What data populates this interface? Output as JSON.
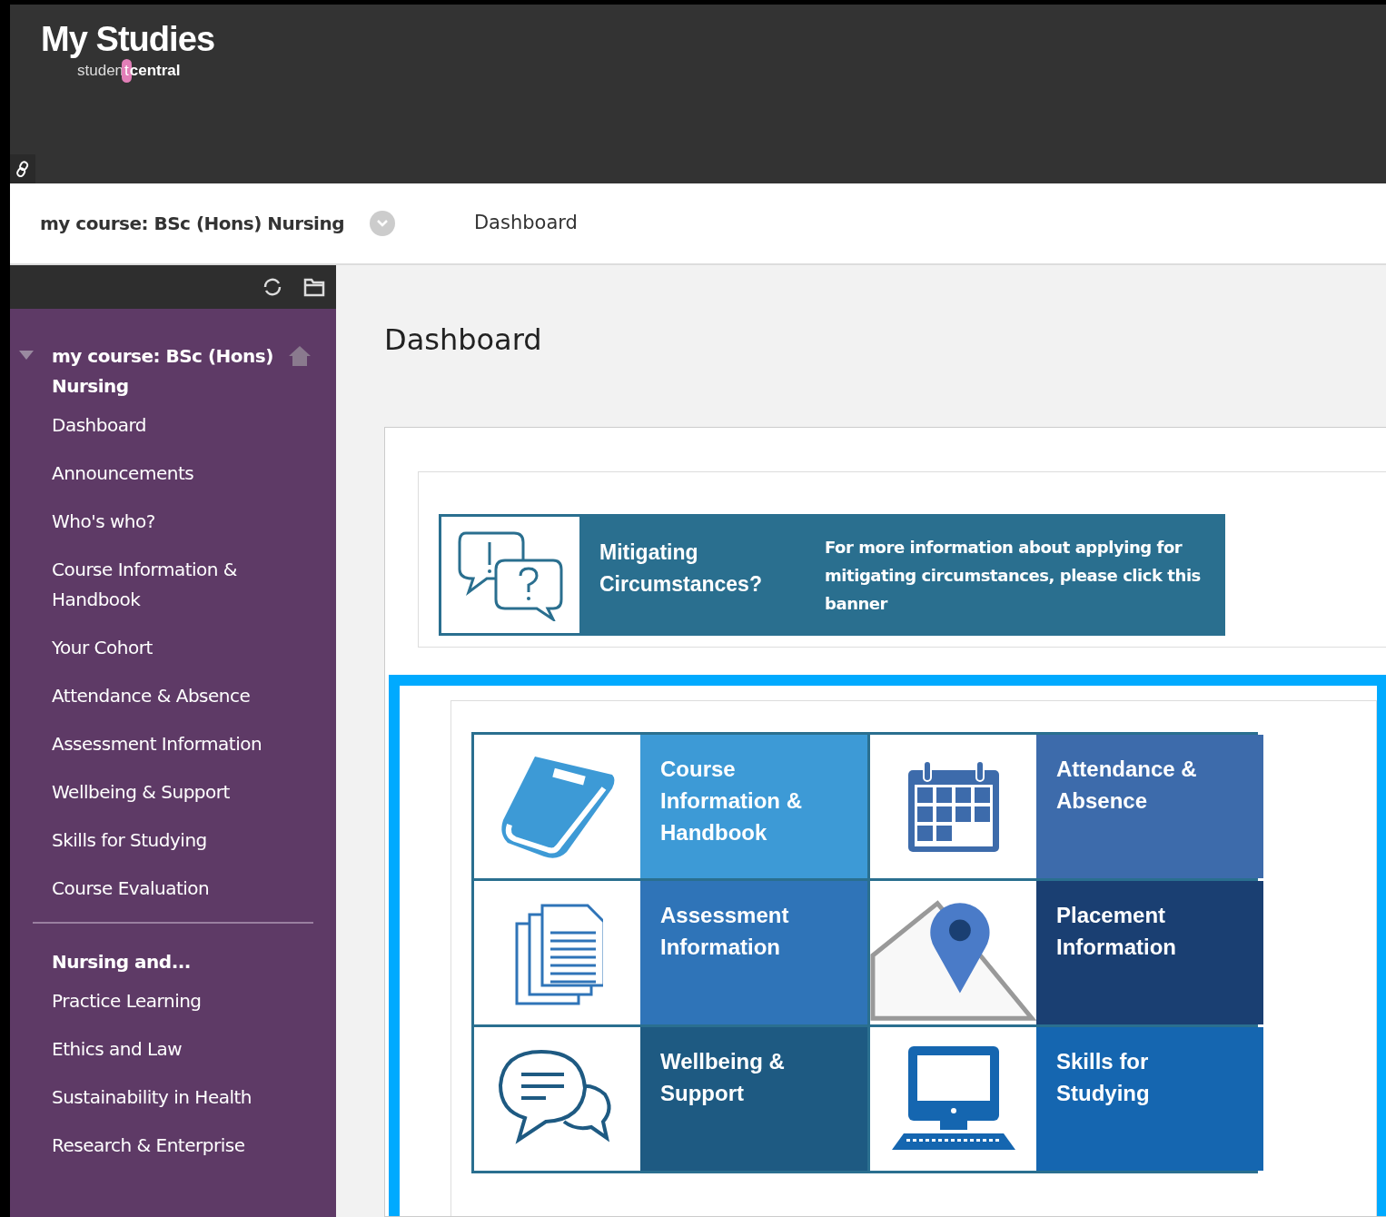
{
  "header": {
    "title": "My Studies",
    "logo_left": "studen",
    "logo_mark": "t",
    "logo_right": "central"
  },
  "breadcrumb": {
    "course": "my course: BSc (Hons) Nursing",
    "page": "Dashboard"
  },
  "sidebar": {
    "course_title": "my course: BSc (Hons) Nursing",
    "expanded": true,
    "items": [
      "Dashboard",
      "Announcements",
      "Who's who?",
      "Course Information & Handbook",
      "Your Cohort",
      "Attendance & Absence",
      "Assessment Information",
      "Wellbeing & Support",
      "Skills for Studying",
      "Course Evaluation"
    ],
    "section_heading": "Nursing and...",
    "section_items": [
      "Practice Learning",
      "Ethics and Law",
      "Sustainability in Health",
      "Research & Enterprise"
    ]
  },
  "page_title": "Dashboard",
  "banner": {
    "title": "Mitigating Circumstances?",
    "text": "For more information about applying for mitigating circumstances, please click this banner"
  },
  "tiles": [
    {
      "label": "Course Information & Handbook",
      "color": "#3d9ad6"
    },
    {
      "label": "Attendance & Absence",
      "color": "#3d6bab"
    },
    {
      "label": "Assessment Information",
      "color": "#2f74b8"
    },
    {
      "label": "Placement Information",
      "color": "#1a3f72"
    },
    {
      "label": "Wellbeing & Support",
      "color": "#1e5a82"
    },
    {
      "label": "Skills for Studying",
      "color": "#1566b0"
    }
  ]
}
